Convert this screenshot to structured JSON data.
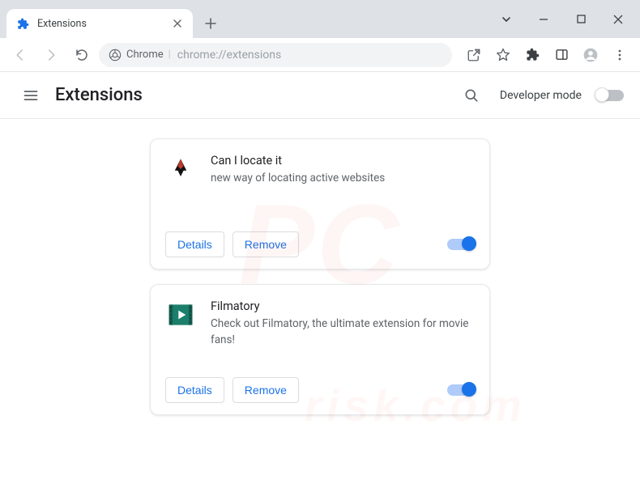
{
  "window": {
    "tab_title": "Extensions"
  },
  "toolbar": {
    "url_host": "Chrome",
    "url_path": "chrome://extensions"
  },
  "header": {
    "title": "Extensions",
    "developer_mode_label": "Developer mode"
  },
  "buttons": {
    "details": "Details",
    "remove": "Remove"
  },
  "extensions": [
    {
      "name": "Can I locate it",
      "description": "new way of locating active websites"
    },
    {
      "name": "Filmatory",
      "description": "Check out Filmatory, the ultimate extension for movie fans!"
    }
  ],
  "watermark": {
    "main": "PC",
    "sub": "risk.com"
  }
}
